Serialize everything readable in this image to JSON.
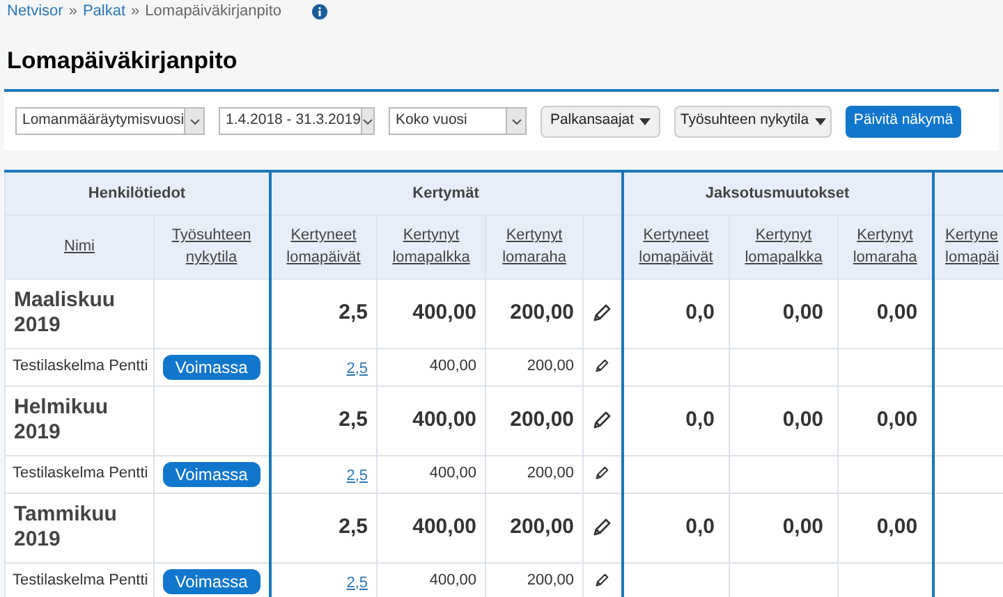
{
  "breadcrumb": [
    {
      "label": "Netvisor",
      "link": true
    },
    {
      "label": "»",
      "link": false
    },
    {
      "label": "Palkat",
      "link": true
    },
    {
      "label": "»",
      "link": false
    },
    {
      "label": "Lomapäiväkirjanpito",
      "link": false
    }
  ],
  "title": "Lomapäiväkirjanpito",
  "filters": [
    {
      "kind": "select",
      "value": "Lomanmääräytymisvuosi"
    },
    {
      "kind": "select",
      "value": "1.4.2018 - 31.3.2019"
    },
    {
      "kind": "select",
      "value": "Koko vuosi"
    },
    {
      "kind": "dropdown",
      "label": "Palkansaajat"
    },
    {
      "kind": "dropdown",
      "label": "Työsuhteen nykytila"
    },
    {
      "kind": "primary",
      "label": "Päivitä näkymä"
    }
  ],
  "table": {
    "groups": [
      {
        "label": "Henkilötiedot"
      },
      {
        "label": "Kertymät"
      },
      {
        "label": "Jaksotusmuutokset"
      }
    ],
    "columns": [
      "Nimi",
      "Työsuhteen nykytila",
      "Kertyneet lomapäivät",
      "Kertynyt lomapalkka",
      "Kertynyt lomaraha",
      "",
      "Kertyneet lomapäivät",
      "Kertynyt lomapalkka",
      "Kertynyt lomaraha",
      "Kertyne lomapäi"
    ],
    "rows": [
      {
        "kind": "month",
        "name": "Maaliskuu 2019",
        "values": [
          "2,5",
          "400,00",
          "200,00",
          "0,0",
          "0,00",
          "0,00"
        ]
      },
      {
        "kind": "person",
        "name": "Testilaskelma Pentti",
        "status": "Voimassa",
        "values": [
          "2,5",
          "400,00",
          "200,00"
        ]
      },
      {
        "kind": "month",
        "name": "Helmikuu 2019",
        "values": [
          "2,5",
          "400,00",
          "200,00",
          "0,0",
          "0,00",
          "0,00"
        ]
      },
      {
        "kind": "person",
        "name": "Testilaskelma Pentti",
        "status": "Voimassa",
        "values": [
          "2,5",
          "400,00",
          "200,00"
        ]
      },
      {
        "kind": "month",
        "name": "Tammikuu 2019",
        "values": [
          "2,5",
          "400,00",
          "200,00",
          "0,0",
          "0,00",
          "0,00"
        ]
      },
      {
        "kind": "person",
        "name": "Testilaskelma Pentti",
        "status": "Voimassa",
        "values": [
          "2,5",
          "400,00",
          "200,00"
        ]
      }
    ]
  }
}
